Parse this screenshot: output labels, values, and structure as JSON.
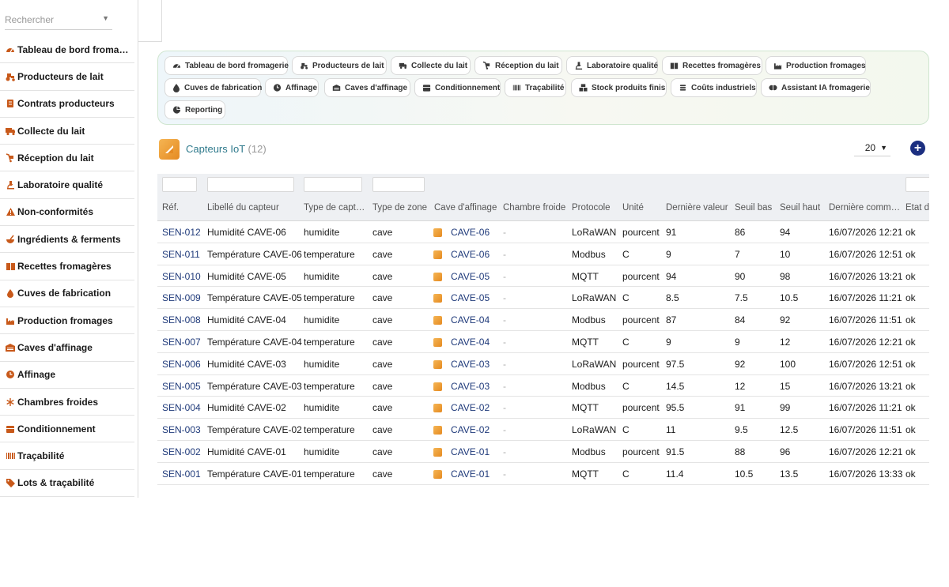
{
  "search": {
    "placeholder": "Rechercher"
  },
  "sidebar": {
    "items": [
      {
        "label": "Tableau de bord fromagerie",
        "icon": "gauge-icon"
      },
      {
        "label": "Producteurs de lait",
        "icon": "tractor-icon"
      },
      {
        "label": "Contrats producteurs",
        "icon": "contract-icon"
      },
      {
        "label": "Collecte du lait",
        "icon": "truck-icon"
      },
      {
        "label": "Réception du lait",
        "icon": "dolly-icon"
      },
      {
        "label": "Laboratoire qualité",
        "icon": "microscope-icon"
      },
      {
        "label": "Non-conformités",
        "icon": "warning-icon"
      },
      {
        "label": "Ingrédients & ferments",
        "icon": "mortar-icon"
      },
      {
        "label": "Recettes fromagères",
        "icon": "book-icon"
      },
      {
        "label": "Cuves de fabrication",
        "icon": "drop-icon"
      },
      {
        "label": "Production fromages",
        "icon": "industry-icon"
      },
      {
        "label": "Caves d'affinage",
        "icon": "warehouse-icon"
      },
      {
        "label": "Affinage",
        "icon": "clock-icon"
      },
      {
        "label": "Chambres froides",
        "icon": "snowflake-icon"
      },
      {
        "label": "Conditionnement",
        "icon": "box-icon"
      },
      {
        "label": "Traçabilité",
        "icon": "barcode-icon"
      },
      {
        "label": "Lots & traçabilité",
        "icon": "tags-icon"
      }
    ]
  },
  "tabs": [
    {
      "label": "Tableau de bord fromagerie",
      "icon": "gauge-icon"
    },
    {
      "label": "Producteurs de lait",
      "icon": "tractor-icon"
    },
    {
      "label": "Collecte du lait",
      "icon": "truck-icon"
    },
    {
      "label": "Réception du lait",
      "icon": "dolly-icon"
    },
    {
      "label": "Laboratoire qualité",
      "icon": "microscope-icon"
    },
    {
      "label": "Recettes fromagères",
      "icon": "book-icon"
    },
    {
      "label": "Production fromages",
      "icon": "industry-icon"
    },
    {
      "label": "Cuves de fabrication",
      "icon": "drop-icon"
    },
    {
      "label": "Affinage",
      "icon": "clock-icon"
    },
    {
      "label": "Caves d'affinage",
      "icon": "warehouse-icon"
    },
    {
      "label": "Conditionnement",
      "icon": "box-icon"
    },
    {
      "label": "Traçabilité",
      "icon": "barcode-icon"
    },
    {
      "label": "Stock produits finis",
      "icon": "boxes-icon"
    },
    {
      "label": "Coûts industriels",
      "icon": "coins-icon"
    },
    {
      "label": "Assistant IA fromagerie",
      "icon": "brain-icon"
    },
    {
      "label": "Reporting",
      "icon": "chart-pie-icon"
    }
  ],
  "page": {
    "title": "Capteurs IoT",
    "count": "(12)",
    "page_size": "20",
    "add_label": "+"
  },
  "table": {
    "headers": [
      "Réf.",
      "Libellé du capteur",
      "Type de capteur",
      "Type de zone",
      "Cave d'affinage",
      "Chambre froide",
      "Protocole",
      "Unité",
      "Dernière valeur",
      "Seuil bas",
      "Seuil haut",
      "Dernière communication",
      "État du capteur"
    ],
    "rows": [
      {
        "ref": "SEN-012",
        "label": "Humidité CAVE-06",
        "type": "humidite",
        "zone": "cave",
        "cave": "CAVE-06",
        "chambre": "-",
        "protocole": "LoRaWAN",
        "unite": "pourcent",
        "valeur": "91",
        "bas": "86",
        "haut": "94",
        "comm": "16/07/2026 12:21",
        "etat": "ok"
      },
      {
        "ref": "SEN-011",
        "label": "Température CAVE-06",
        "type": "temperature",
        "zone": "cave",
        "cave": "CAVE-06",
        "chambre": "-",
        "protocole": "Modbus",
        "unite": "C",
        "valeur": "9",
        "bas": "7",
        "haut": "10",
        "comm": "16/07/2026 12:51",
        "etat": "ok"
      },
      {
        "ref": "SEN-010",
        "label": "Humidité CAVE-05",
        "type": "humidite",
        "zone": "cave",
        "cave": "CAVE-05",
        "chambre": "-",
        "protocole": "MQTT",
        "unite": "pourcent",
        "valeur": "94",
        "bas": "90",
        "haut": "98",
        "comm": "16/07/2026 13:21",
        "etat": "ok"
      },
      {
        "ref": "SEN-009",
        "label": "Température CAVE-05",
        "type": "temperature",
        "zone": "cave",
        "cave": "CAVE-05",
        "chambre": "-",
        "protocole": "LoRaWAN",
        "unite": "C",
        "valeur": "8.5",
        "bas": "7.5",
        "haut": "10.5",
        "comm": "16/07/2026 11:21",
        "etat": "ok"
      },
      {
        "ref": "SEN-008",
        "label": "Humidité CAVE-04",
        "type": "humidite",
        "zone": "cave",
        "cave": "CAVE-04",
        "chambre": "-",
        "protocole": "Modbus",
        "unite": "pourcent",
        "valeur": "87",
        "bas": "84",
        "haut": "92",
        "comm": "16/07/2026 11:51",
        "etat": "ok"
      },
      {
        "ref": "SEN-007",
        "label": "Température CAVE-04",
        "type": "temperature",
        "zone": "cave",
        "cave": "CAVE-04",
        "chambre": "-",
        "protocole": "MQTT",
        "unite": "C",
        "valeur": "9",
        "bas": "9",
        "haut": "12",
        "comm": "16/07/2026 12:21",
        "etat": "ok"
      },
      {
        "ref": "SEN-006",
        "label": "Humidité CAVE-03",
        "type": "humidite",
        "zone": "cave",
        "cave": "CAVE-03",
        "chambre": "-",
        "protocole": "LoRaWAN",
        "unite": "pourcent",
        "valeur": "97.5",
        "bas": "92",
        "haut": "100",
        "comm": "16/07/2026 12:51",
        "etat": "ok"
      },
      {
        "ref": "SEN-005",
        "label": "Température CAVE-03",
        "type": "temperature",
        "zone": "cave",
        "cave": "CAVE-03",
        "chambre": "-",
        "protocole": "Modbus",
        "unite": "C",
        "valeur": "14.5",
        "bas": "12",
        "haut": "15",
        "comm": "16/07/2026 13:21",
        "etat": "ok"
      },
      {
        "ref": "SEN-004",
        "label": "Humidité CAVE-02",
        "type": "humidite",
        "zone": "cave",
        "cave": "CAVE-02",
        "chambre": "-",
        "protocole": "MQTT",
        "unite": "pourcent",
        "valeur": "95.5",
        "bas": "91",
        "haut": "99",
        "comm": "16/07/2026 11:21",
        "etat": "ok"
      },
      {
        "ref": "SEN-003",
        "label": "Température CAVE-02",
        "type": "temperature",
        "zone": "cave",
        "cave": "CAVE-02",
        "chambre": "-",
        "protocole": "LoRaWAN",
        "unite": "C",
        "valeur": "11",
        "bas": "9.5",
        "haut": "12.5",
        "comm": "16/07/2026 11:51",
        "etat": "ok"
      },
      {
        "ref": "SEN-002",
        "label": "Humidité CAVE-01",
        "type": "humidite",
        "zone": "cave",
        "cave": "CAVE-01",
        "chambre": "-",
        "protocole": "Modbus",
        "unite": "pourcent",
        "valeur": "91.5",
        "bas": "88",
        "haut": "96",
        "comm": "16/07/2026 12:21",
        "etat": "ok"
      },
      {
        "ref": "SEN-001",
        "label": "Température CAVE-01",
        "type": "temperature",
        "zone": "cave",
        "cave": "CAVE-01",
        "chambre": "-",
        "protocole": "MQTT",
        "unite": "C",
        "valeur": "11.4",
        "bas": "10.5",
        "haut": "13.5",
        "comm": "16/07/2026 13:33",
        "etat": "ok"
      }
    ]
  },
  "colors": {
    "accent": "#e58a22",
    "link": "#1f3a7a",
    "title": "#2f7a8c",
    "add_button": "#1c2f80"
  }
}
